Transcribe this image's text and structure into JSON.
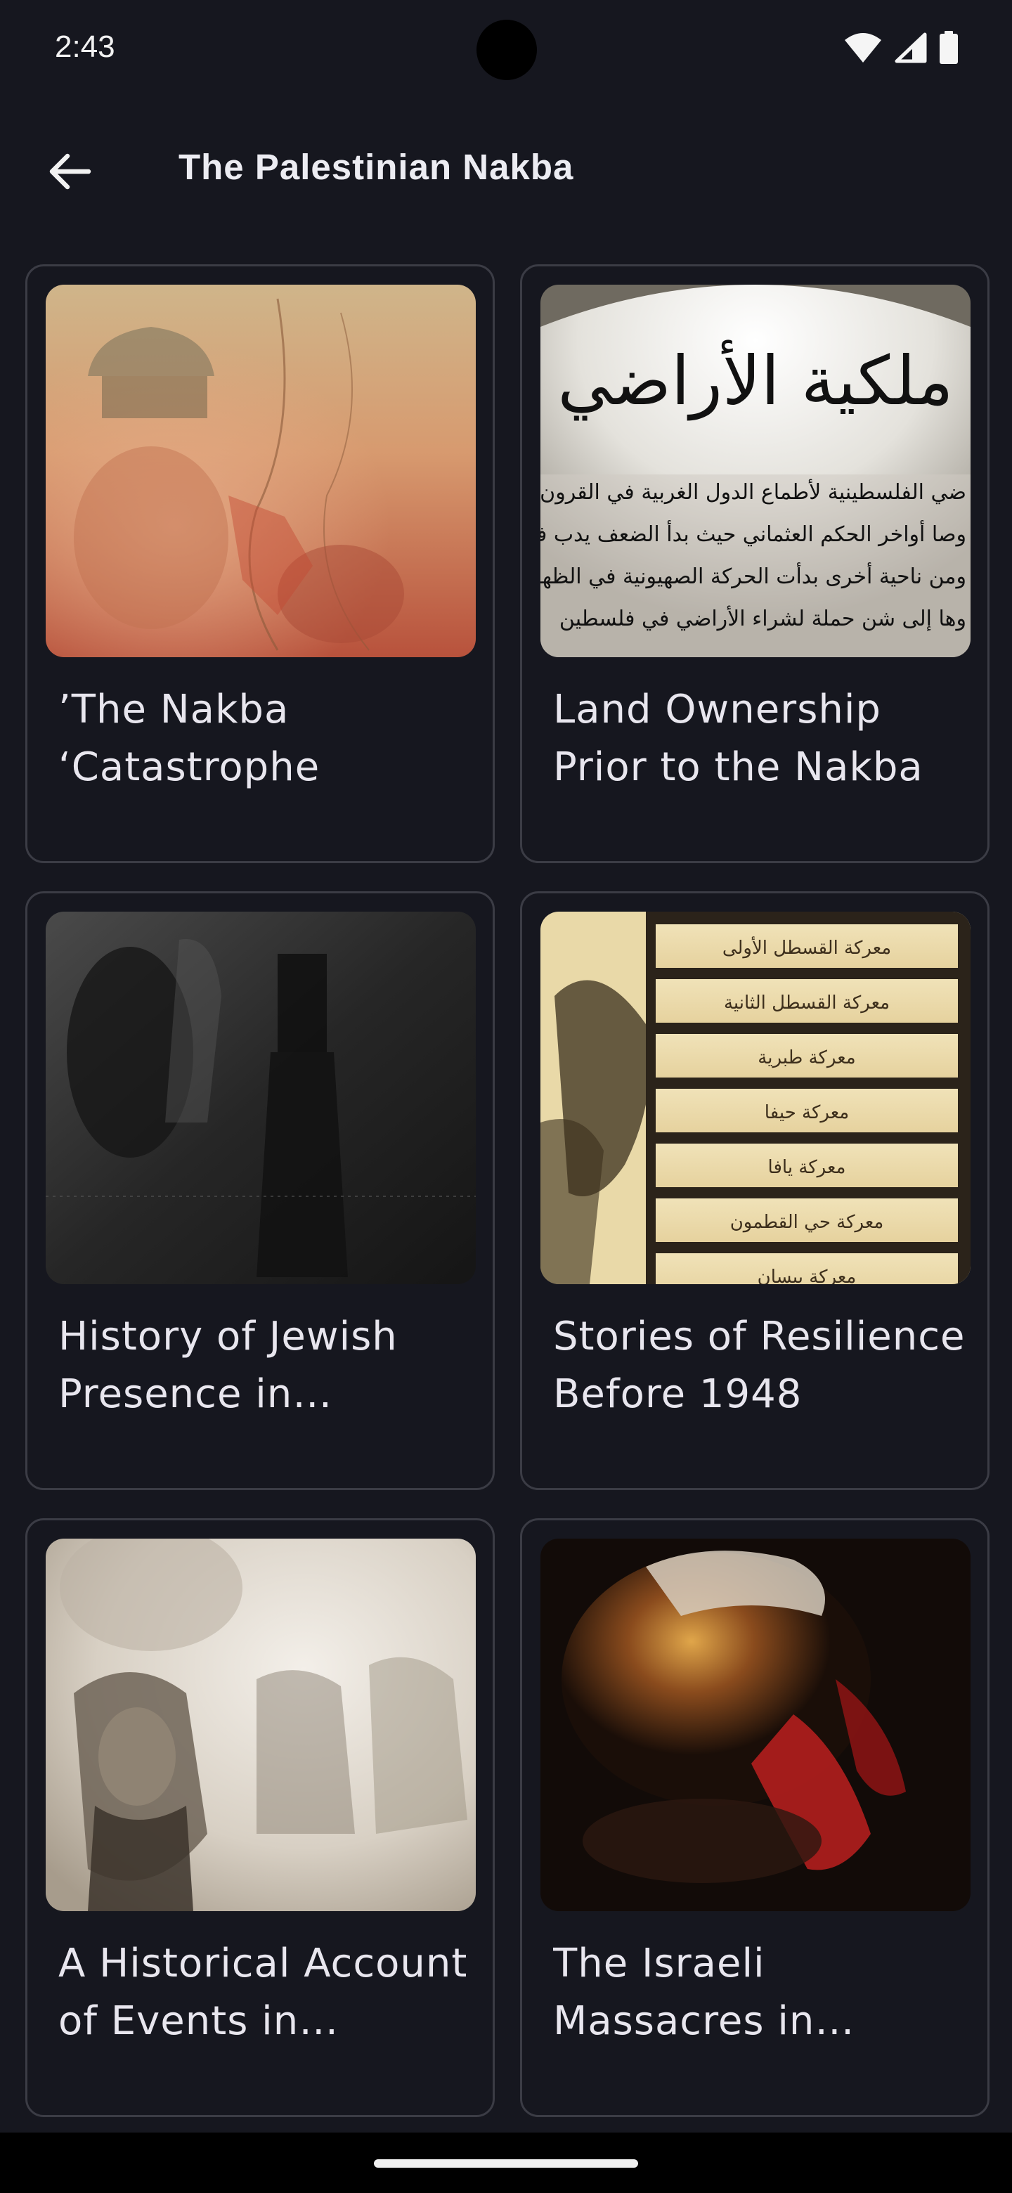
{
  "status_bar": {
    "time": "2:43",
    "icons": [
      "wifi-icon",
      "cellular-signal-icon",
      "battery-icon"
    ]
  },
  "app_bar": {
    "back_icon": "arrow-left-icon",
    "title": "The Palestinian Nakba"
  },
  "cards": [
    {
      "title": "’The Nakba ‘Catastrophe",
      "image": "collage of map, Dome of the Rock and faces in sepia and red tones"
    },
    {
      "title": "Land Ownership Prior to the Nakba",
      "image": "Arabic text poster about land ownership",
      "image_text_heading": "ملكية الأراضي",
      "image_text_lines": [
        "ضي الفلسطينية لأطماع الدول الغربية في القرون",
        "وصا أواخر الحكم العثماني حيث بدأ الضعف يدب في",
        "ومن ناحية أخرى بدأت الحركة الصهيونية في الظهور",
        "وها إلى شن حملة لشراء الأراضي في فلسطين"
      ]
    },
    {
      "title": "History of Jewish Presence in Palestine",
      "image": "dark archival photo of figures"
    },
    {
      "title": "Stories of Resilience Before 1948",
      "image": "list of battles in Arabic on a paper background",
      "image_text_lines": [
        "معركة القسطل الأولى",
        "معركة القسطل الثانية",
        "معركة طبرية",
        "معركة حيفا",
        "معركة يافا",
        "معركة حي القطمون",
        "معركة بيسان"
      ]
    },
    {
      "title": "A Historical Account of Events in Palestine",
      "image": "sepia photo of an elderly woman and refugees"
    },
    {
      "title": "The Israeli Massacres in Palestine",
      "image": "dark photo with red fabric"
    }
  ],
  "colors": {
    "background": "#16171f",
    "card_border": "#3b3c45",
    "text": "#e8e6ee"
  }
}
